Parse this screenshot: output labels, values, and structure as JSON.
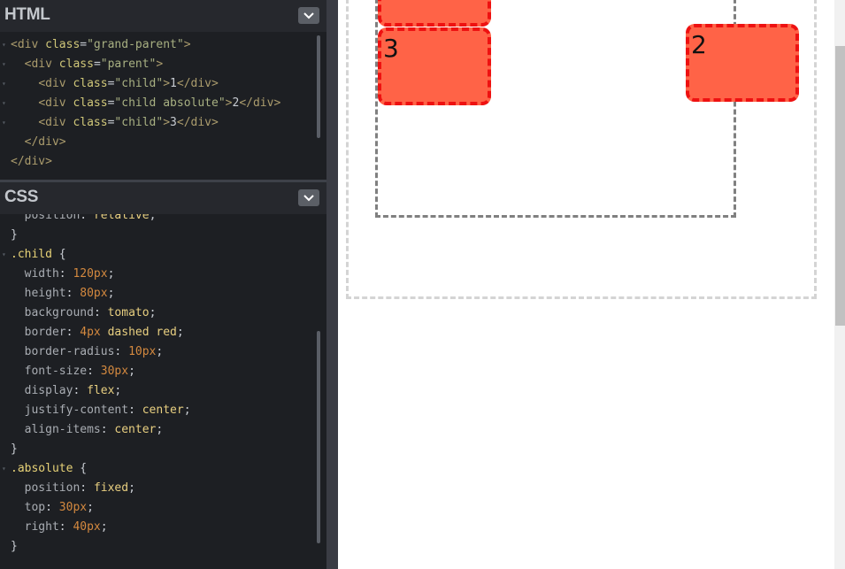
{
  "html_panel": {
    "title": "HTML",
    "lines": [
      {
        "indent": "",
        "fold": true,
        "tokens": [
          [
            "tag",
            "<div "
          ],
          [
            "attr",
            "class"
          ],
          [
            "punc",
            "="
          ],
          [
            "str",
            "\"grand-parent\""
          ],
          [
            "tag",
            ">"
          ]
        ]
      },
      {
        "indent": "  ",
        "fold": true,
        "tokens": [
          [
            "tag",
            "<div "
          ],
          [
            "attr",
            "class"
          ],
          [
            "punc",
            "="
          ],
          [
            "str",
            "\"parent\""
          ],
          [
            "tag",
            ">"
          ]
        ]
      },
      {
        "indent": "    ",
        "fold": true,
        "tokens": [
          [
            "tag",
            "<div "
          ],
          [
            "attr",
            "class"
          ],
          [
            "punc",
            "="
          ],
          [
            "str",
            "\"child\""
          ],
          [
            "tag",
            ">"
          ],
          [
            "txt",
            "1"
          ],
          [
            "tag",
            "</div>"
          ]
        ]
      },
      {
        "indent": "    ",
        "fold": true,
        "tokens": [
          [
            "tag",
            "<div "
          ],
          [
            "attr",
            "class"
          ],
          [
            "punc",
            "="
          ],
          [
            "str",
            "\"child absolute\""
          ],
          [
            "tag",
            ">"
          ],
          [
            "txt",
            "2"
          ],
          [
            "tag",
            "</div>"
          ]
        ]
      },
      {
        "indent": "    ",
        "fold": true,
        "tokens": [
          [
            "tag",
            "<div "
          ],
          [
            "attr",
            "class"
          ],
          [
            "punc",
            "="
          ],
          [
            "str",
            "\"child\""
          ],
          [
            "tag",
            ">"
          ],
          [
            "txt",
            "3"
          ],
          [
            "tag",
            "</div>"
          ]
        ]
      },
      {
        "indent": "  ",
        "fold": false,
        "tokens": [
          [
            "tag",
            "</div>"
          ]
        ]
      },
      {
        "indent": "",
        "fold": false,
        "tokens": [
          [
            "tag",
            "</div>"
          ]
        ]
      }
    ]
  },
  "css_panel": {
    "title": "CSS",
    "lines": [
      {
        "indent": "  ",
        "fold": false,
        "tokens": [
          [
            "prop",
            "position"
          ],
          [
            "punc",
            ": "
          ],
          [
            "kw",
            "relative"
          ],
          [
            "punc",
            ";"
          ]
        ]
      },
      {
        "indent": "",
        "fold": false,
        "tokens": [
          [
            "punc",
            "}"
          ]
        ]
      },
      {
        "indent": "",
        "fold": true,
        "tokens": [
          [
            "sel",
            ".child "
          ],
          [
            "punc",
            "{"
          ]
        ]
      },
      {
        "indent": "  ",
        "fold": false,
        "tokens": [
          [
            "prop",
            "width"
          ],
          [
            "punc",
            ": "
          ],
          [
            "num",
            "120px"
          ],
          [
            "punc",
            ";"
          ]
        ]
      },
      {
        "indent": "  ",
        "fold": false,
        "tokens": [
          [
            "prop",
            "height"
          ],
          [
            "punc",
            ": "
          ],
          [
            "num",
            "80px"
          ],
          [
            "punc",
            ";"
          ]
        ]
      },
      {
        "indent": "  ",
        "fold": false,
        "tokens": [
          [
            "prop",
            "background"
          ],
          [
            "punc",
            ": "
          ],
          [
            "kw",
            "tomato"
          ],
          [
            "punc",
            ";"
          ]
        ]
      },
      {
        "indent": "  ",
        "fold": false,
        "tokens": [
          [
            "prop",
            "border"
          ],
          [
            "punc",
            ": "
          ],
          [
            "num",
            "4px"
          ],
          [
            "punc",
            " "
          ],
          [
            "kw",
            "dashed red"
          ],
          [
            "punc",
            ";"
          ]
        ]
      },
      {
        "indent": "  ",
        "fold": false,
        "tokens": [
          [
            "prop",
            "border-radius"
          ],
          [
            "punc",
            ": "
          ],
          [
            "num",
            "10px"
          ],
          [
            "punc",
            ";"
          ]
        ]
      },
      {
        "indent": "  ",
        "fold": false,
        "tokens": [
          [
            "prop",
            "font-size"
          ],
          [
            "punc",
            ": "
          ],
          [
            "num",
            "30px"
          ],
          [
            "punc",
            ";"
          ]
        ]
      },
      {
        "indent": "  ",
        "fold": false,
        "tokens": [
          [
            "prop",
            "display"
          ],
          [
            "punc",
            ": "
          ],
          [
            "kw",
            "flex"
          ],
          [
            "punc",
            ";"
          ]
        ]
      },
      {
        "indent": "  ",
        "fold": false,
        "tokens": [
          [
            "prop",
            "justify-content"
          ],
          [
            "punc",
            ": "
          ],
          [
            "kw",
            "center"
          ],
          [
            "punc",
            ";"
          ]
        ]
      },
      {
        "indent": "  ",
        "fold": false,
        "tokens": [
          [
            "prop",
            "align-items"
          ],
          [
            "punc",
            ": "
          ],
          [
            "kw",
            "center"
          ],
          [
            "punc",
            ";"
          ]
        ]
      },
      {
        "indent": "",
        "fold": false,
        "tokens": [
          [
            "punc",
            "}"
          ]
        ]
      },
      {
        "indent": "",
        "fold": true,
        "tokens": [
          [
            "sel",
            ".absolute "
          ],
          [
            "punc",
            "{"
          ]
        ]
      },
      {
        "indent": "  ",
        "fold": false,
        "tokens": [
          [
            "prop",
            "position"
          ],
          [
            "punc",
            ": "
          ],
          [
            "kw",
            "fixed"
          ],
          [
            "punc",
            ";"
          ]
        ]
      },
      {
        "indent": "  ",
        "fold": false,
        "tokens": [
          [
            "prop",
            "top"
          ],
          [
            "punc",
            ": "
          ],
          [
            "num",
            "30px"
          ],
          [
            "punc",
            ";"
          ]
        ]
      },
      {
        "indent": "  ",
        "fold": false,
        "tokens": [
          [
            "prop",
            "right"
          ],
          [
            "punc",
            ": "
          ],
          [
            "num",
            "40px"
          ],
          [
            "punc",
            ";"
          ]
        ]
      },
      {
        "indent": "",
        "fold": false,
        "tokens": [
          [
            "punc",
            "}"
          ]
        ]
      }
    ]
  },
  "preview": {
    "child_1_label": "",
    "child_2_label": "2",
    "child_3_label": "3"
  },
  "colors": {
    "child_background": "#ff6347",
    "child_border": "#ee1111",
    "grand_parent_border": "#d4d4d4",
    "parent_border": "#808080"
  },
  "icons": {
    "panel_toggle": "chevron-down-icon",
    "fold_marker": "fold-triangle-icon"
  }
}
